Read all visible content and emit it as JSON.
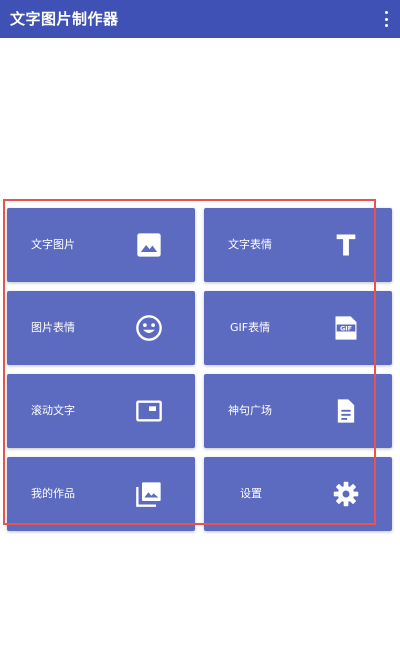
{
  "appbar": {
    "title": "文字图片制作器",
    "menu_icon": "more-vert-icon"
  },
  "colors": {
    "primary": "#3f51b5",
    "tile": "#5c6bc0",
    "highlight": "#e8524f"
  },
  "tiles": [
    {
      "label": "文字图片",
      "icon": "image-icon"
    },
    {
      "label": "文字表情",
      "icon": "text-t-icon"
    },
    {
      "label": "图片表情",
      "icon": "smiley-icon"
    },
    {
      "label": "GIF表情",
      "icon": "gif-icon"
    },
    {
      "label": "滚动文字",
      "icon": "scroll-frame-icon"
    },
    {
      "label": "神句广场",
      "icon": "document-icon"
    },
    {
      "label": "我的作品",
      "icon": "photo-library-icon"
    },
    {
      "label": "设置",
      "icon": "settings-gear-icon"
    }
  ]
}
